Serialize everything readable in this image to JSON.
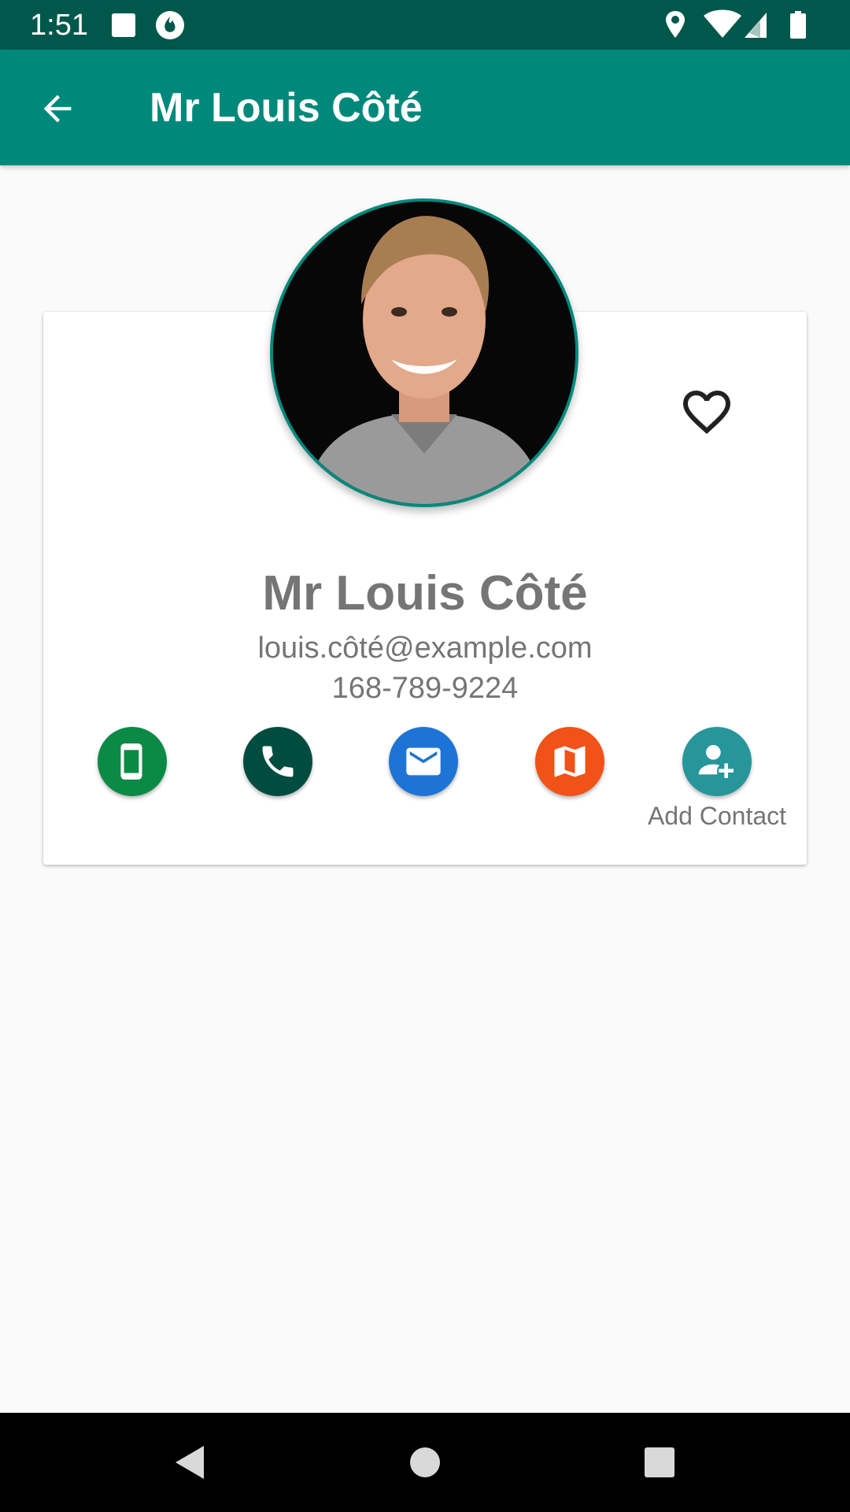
{
  "status_bar": {
    "time": "1:51",
    "icons": [
      "square-icon",
      "fire-icon",
      "location-icon",
      "wifi-icon",
      "signal-icon",
      "battery-icon"
    ]
  },
  "app_bar": {
    "title": "Mr Louis Côté",
    "back_icon": "arrow-back-icon",
    "background": "#00897b"
  },
  "contact": {
    "name": "Mr Louis Côté",
    "email": "louis.côté@example.com",
    "phone": "168-789-9224",
    "favorite_icon": "heart-outline-icon"
  },
  "actions": [
    {
      "icon": "mobile-phone-icon",
      "color": "#0b8a46"
    },
    {
      "icon": "phone-call-icon",
      "color": "#004d40"
    },
    {
      "icon": "email-icon",
      "color": "#1e74d6"
    },
    {
      "icon": "map-icon",
      "color": "#f05217"
    },
    {
      "icon": "add-contact-icon",
      "color": "#26969a",
      "label": "Add Contact"
    }
  ],
  "nav_bar": {
    "buttons": [
      "back-triangle-icon",
      "home-circle-icon",
      "recents-square-icon"
    ]
  }
}
